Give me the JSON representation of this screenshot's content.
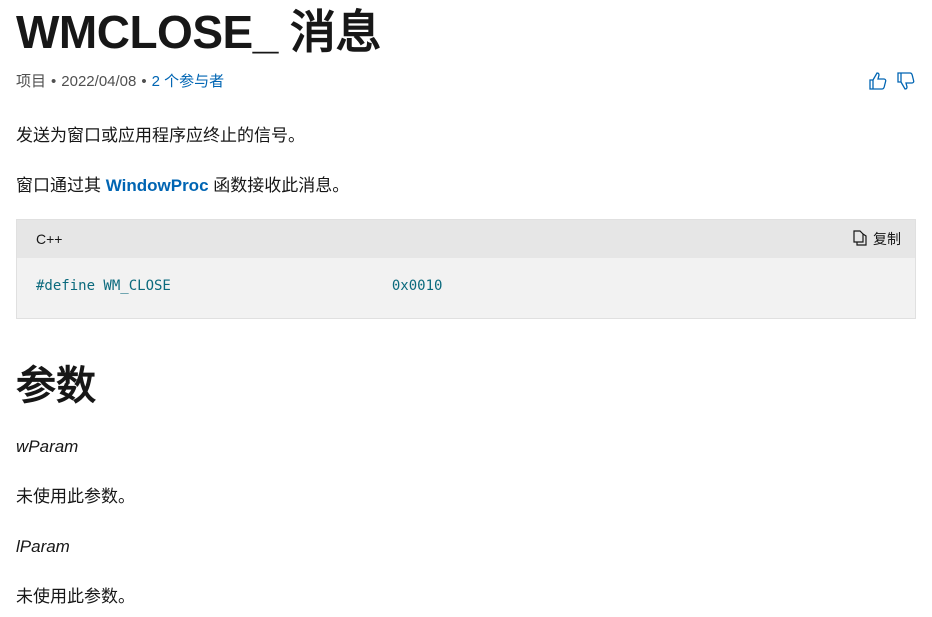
{
  "title": "WMCLOSE_ 消息",
  "meta": {
    "type": "项目",
    "date": "2022/04/08",
    "contributors": "2 个参与者",
    "separator": "•"
  },
  "feedback": {
    "like_icon": "thumbs-up-icon",
    "dislike_icon": "thumbs-down-icon"
  },
  "intro": "发送为窗口或应用程序应终止的信号。",
  "receive": {
    "prefix": "窗口通过其 ",
    "link": "WindowProc",
    "suffix": " 函数接收此消息。"
  },
  "code": {
    "language": "C++",
    "copy_label": "复制",
    "define": "#define WM_CLOSE",
    "value": "0x0010"
  },
  "params": {
    "heading": "参数",
    "wparam": "wParam",
    "wparam_desc": "未使用此参数。",
    "lparam": "lParam",
    "lparam_desc": "未使用此参数。"
  }
}
